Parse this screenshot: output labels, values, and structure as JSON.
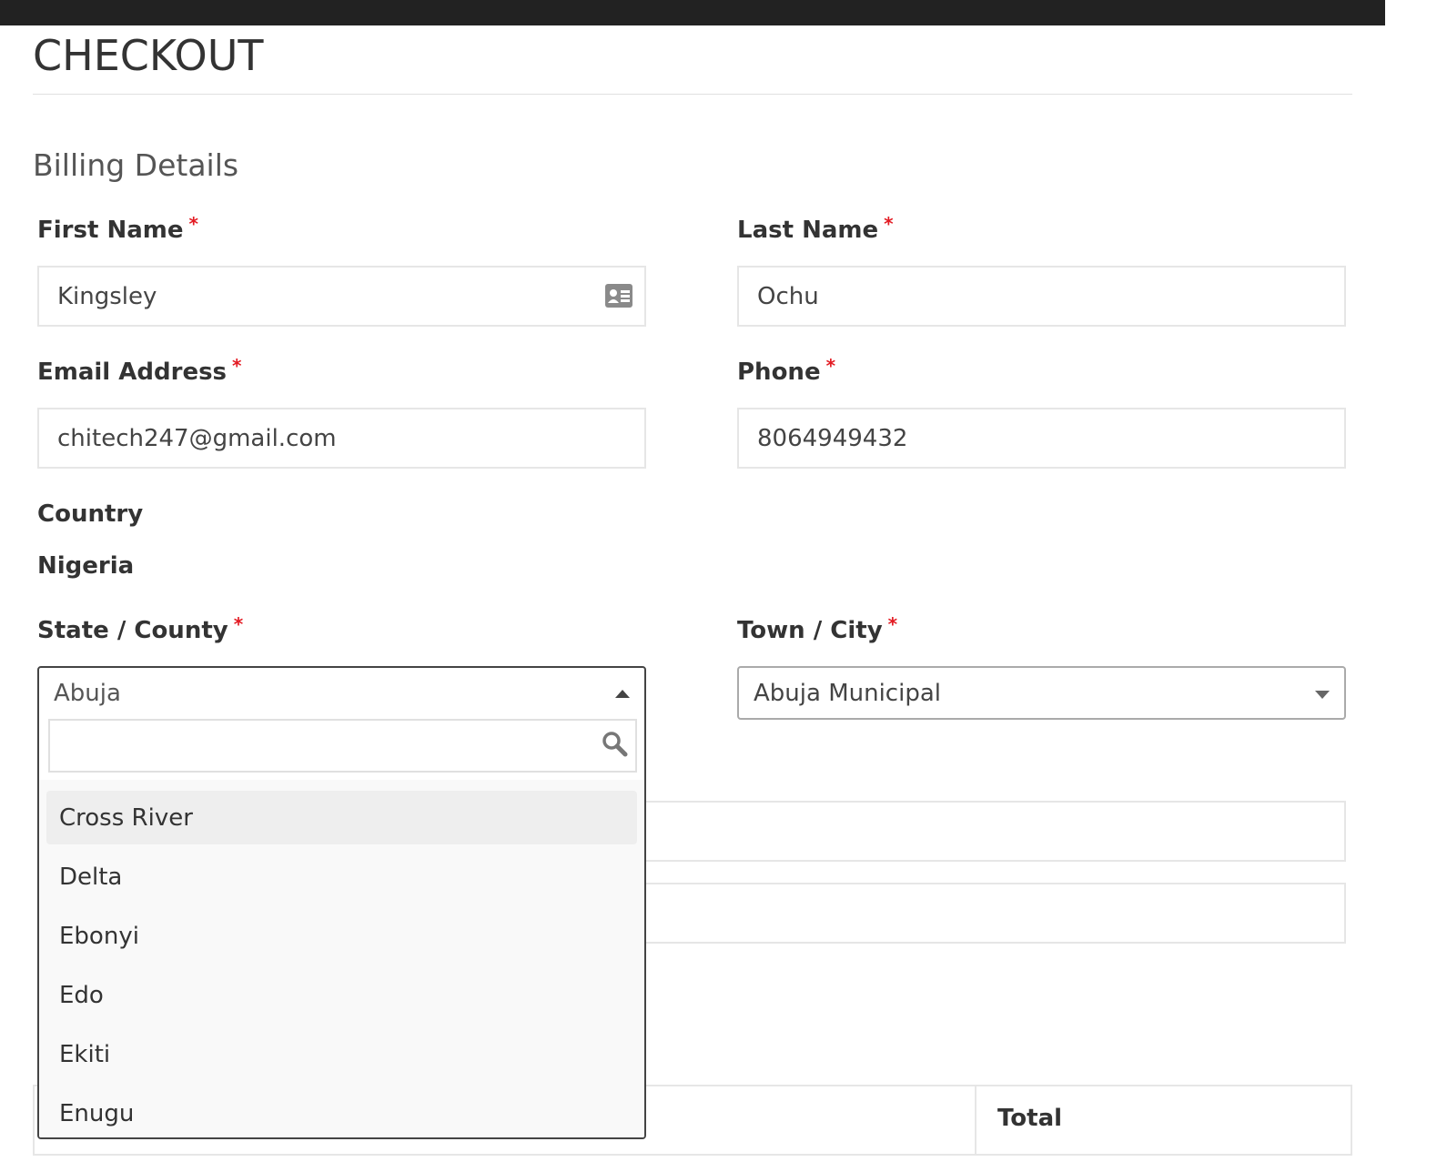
{
  "page": {
    "title": "CHECKOUT",
    "section_title": "Billing Details"
  },
  "form": {
    "first_name": {
      "label": "First Name",
      "required_mark": "*",
      "value": "Kingsley",
      "icon": "contact-card-icon"
    },
    "last_name": {
      "label": "Last Name",
      "required_mark": "*",
      "value": "Ochu"
    },
    "email": {
      "label": "Email Address",
      "required_mark": "*",
      "value": "chitech247@gmail.com"
    },
    "phone": {
      "label": "Phone",
      "required_mark": "*",
      "value": "8064949432"
    },
    "country": {
      "label": "Country",
      "value": "Nigeria"
    },
    "state": {
      "label": "State / County",
      "required_mark": "*",
      "selected": "Abuja"
    },
    "town": {
      "label": "Town / City",
      "required_mark": "*",
      "selected": "Abuja Municipal"
    }
  },
  "state_dropdown": {
    "search_value": "",
    "search_icon": "search-icon",
    "options": [
      "Cross River",
      "Delta",
      "Ebonyi",
      "Edo",
      "Ekiti",
      "Enugu"
    ],
    "highlighted_index": 0
  },
  "order_table": {
    "total_header": "Total"
  },
  "colors": {
    "required": "#e31b23",
    "topbar": "#222222",
    "highlight": "#eeeeee",
    "dropdown_bg": "#f9f9f9"
  }
}
